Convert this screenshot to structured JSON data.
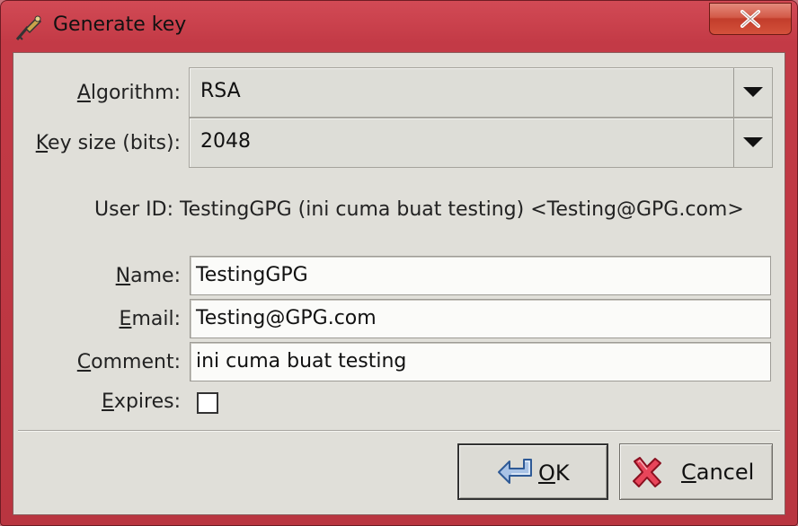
{
  "window": {
    "title": "Generate key",
    "close_glyph": "✕"
  },
  "form": {
    "algorithm": {
      "label_mnemonic": "A",
      "label_rest": "lgorithm:",
      "value": "RSA"
    },
    "key_size": {
      "label_mnemonic": "K",
      "label_rest": "ey size (bits):",
      "value": "2048"
    },
    "user_id": "User ID: TestingGPG (ini cuma buat testing) <Testing@GPG.com>",
    "name": {
      "label_mnemonic": "N",
      "label_rest": "ame:",
      "value": "TestingGPG"
    },
    "email": {
      "label_mnemonic": "E",
      "label_rest": "mail:",
      "value": "Testing@GPG.com"
    },
    "comment": {
      "label_mnemonic": "C",
      "label_rest": "omment:",
      "value": "ini cuma buat testing"
    },
    "expires": {
      "label_mnemonic": "E",
      "label_rest": "xpires:",
      "checked": false
    }
  },
  "buttons": {
    "ok": {
      "mnemonic": "O",
      "rest": "K",
      "icon": "enter-arrow-icon"
    },
    "cancel": {
      "mnemonic": "C",
      "rest": "ancel",
      "icon": "red-x-icon"
    }
  },
  "colors": {
    "titlebar": "#c33a46",
    "client": "#e0dfd9",
    "close_button": "#c94530"
  }
}
